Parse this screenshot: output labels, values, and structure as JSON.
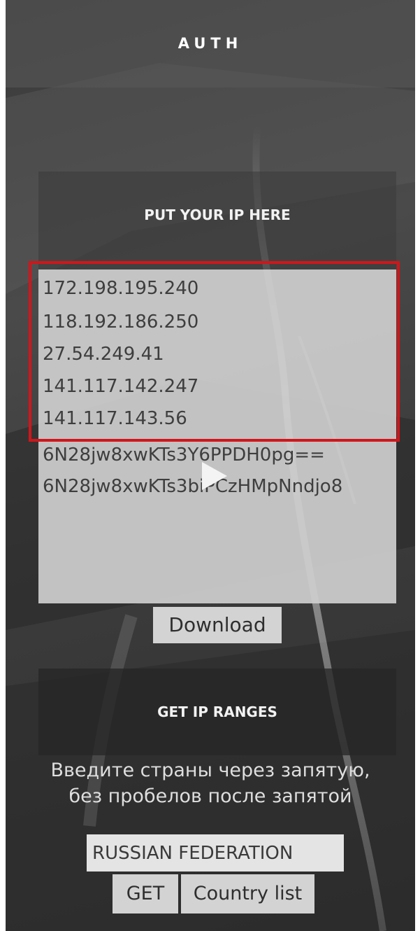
{
  "header": {
    "title": "AUTH"
  },
  "ip_section": {
    "title": "PUT YOUR IP HERE",
    "lines": [
      "172.198.195.240",
      "118.192.186.250",
      "27.54.249.41",
      "141.117.142.247",
      "141.117.143.56",
      "6N28jw8xwKTs3Y6PPDH0pg==",
      "6N28jw8xwKTs3biPCzHMpNndjo8"
    ],
    "download_label": "Download"
  },
  "ranges_section": {
    "title": "GET IP RANGES",
    "hint_line1": "Введите страны через запятую,",
    "hint_line2": "без пробелов после запятой",
    "country_value": "RUSSIAN FEDERATION",
    "get_label": "GET",
    "country_list_label": "Country list"
  },
  "colors": {
    "highlight": "#d0161b"
  },
  "icons": {
    "play": "play-icon"
  }
}
